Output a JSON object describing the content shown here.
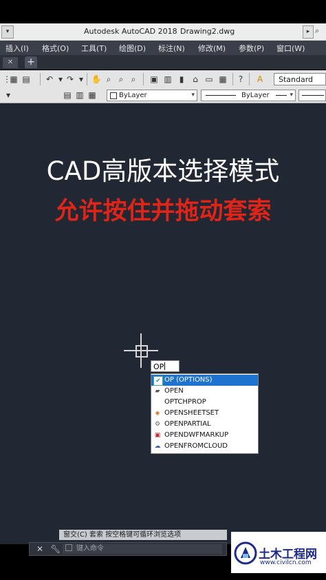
{
  "app": {
    "title": "Autodesk AutoCAD 2018",
    "document": "Drawing2.dwg"
  },
  "menu": {
    "items": [
      "插入(I)",
      "格式(O)",
      "工具(T)",
      "绘图(D)",
      "标注(N)",
      "修改(M)",
      "参数(P)",
      "窗口(W)"
    ]
  },
  "toolbar": {
    "text_style": "Standard",
    "color_combo": "ByLayer",
    "linetype_combo": "ByLayer"
  },
  "canvas": {
    "headline": "CAD高版本选择模式",
    "subheadline": "允许按住并拖动套索",
    "colors": {
      "background": "#212834",
      "headline": "#ffffff",
      "subheadline": "#e02418",
      "selection": "#1f73cf"
    }
  },
  "command": {
    "input_value": "OP",
    "suggestions": [
      {
        "label": "OP (OPTIONS)",
        "icon": "options-check-icon",
        "selected": true
      },
      {
        "label": "OPEN",
        "icon": "open-folder-icon",
        "selected": false
      },
      {
        "label": "OPTCHPROP",
        "icon": "",
        "selected": false
      },
      {
        "label": "OPENSHEETSET",
        "icon": "sheetset-icon",
        "selected": false
      },
      {
        "label": "OPENPARTIAL",
        "icon": "gear-icon",
        "selected": false
      },
      {
        "label": "OPENDWFMARKUP",
        "icon": "markup-icon",
        "selected": false
      },
      {
        "label": "OPENFROMCLOUD",
        "icon": "cloud-icon",
        "selected": false
      }
    ],
    "prompt_hint": "窗交(C) 套索  按空格键可循环浏览选项",
    "command_placeholder": "键入命令"
  },
  "watermark": {
    "title": "土木工程网",
    "url": "www.civilcn.com"
  }
}
